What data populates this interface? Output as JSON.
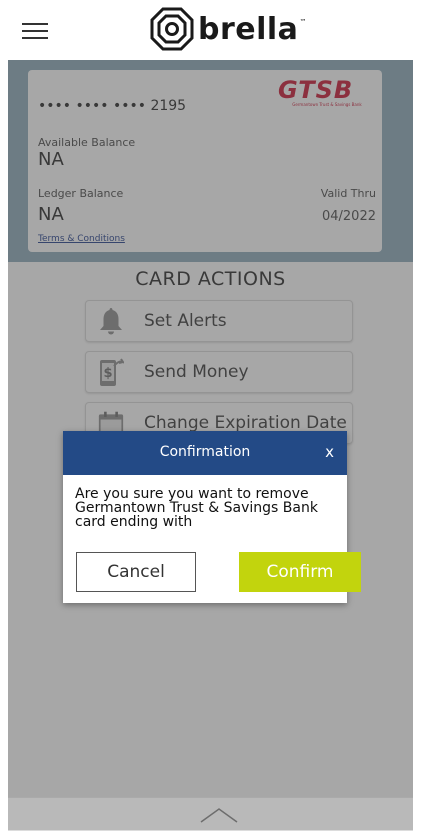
{
  "header": {
    "logo_text": "brella",
    "logo_tm": "™"
  },
  "card": {
    "number": "•••• •••• •••• 2195",
    "bank_logo_text": "GTSB",
    "bank_logo_subtext": "Germantown Trust & Savings Bank",
    "available_balance_label": "Available Balance",
    "available_balance_value": "NA",
    "ledger_balance_label": "Ledger Balance",
    "ledger_balance_value": "NA",
    "valid_thru_label": "Valid Thru",
    "valid_thru_value": "04/2022",
    "terms_link": "Terms & Conditions"
  },
  "actions": {
    "title": "CARD ACTIONS",
    "items": [
      {
        "label": "Set Alerts",
        "icon": "bell-icon"
      },
      {
        "label": "Send Money",
        "icon": "send-money-icon"
      },
      {
        "label": "Change Expiration Date",
        "icon": "calendar-icon"
      }
    ]
  },
  "modal": {
    "title": "Confirmation",
    "close_label": "x",
    "message": "Are you sure you want to remove Germantown Trust & Savings Bank card ending with",
    "cancel_label": "Cancel",
    "confirm_label": "Confirm"
  },
  "colors": {
    "modal_header": "#234a86",
    "confirm_button": "#c2d40d",
    "card_band": "#8aa9b9",
    "bank_brand": "#c8102e"
  }
}
